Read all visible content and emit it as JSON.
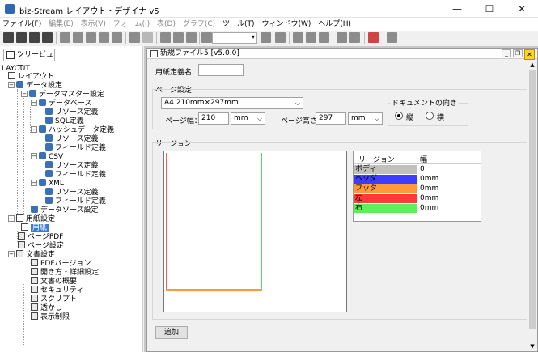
{
  "window": {
    "title": "biz-Stream レイアウト・デザイナ v5",
    "minimize": "—",
    "maximize": "☐",
    "close": "✕"
  },
  "menu": [
    {
      "label": "ファイル(F)",
      "enabled": true
    },
    {
      "label": "編集(E)",
      "enabled": false
    },
    {
      "label": "表示(V)",
      "enabled": false
    },
    {
      "label": "フォーム(I)",
      "enabled": false
    },
    {
      "label": "表(D)",
      "enabled": false
    },
    {
      "label": "グラフ(C)",
      "enabled": false
    },
    {
      "label": "ツール(T)",
      "enabled": true
    },
    {
      "label": "ウィンドウ(W)",
      "enabled": true
    },
    {
      "label": "ヘルプ(H)",
      "enabled": true
    }
  ],
  "toolbar": {
    "zoom_value": "",
    "zoom_arrow": "▾"
  },
  "tree_panel": {
    "tab_label": "ツリービュー",
    "root_label": "LAYOUT",
    "nodes": [
      {
        "label": "レイアウト",
        "expander": ""
      },
      {
        "label": "データ設定",
        "expander": "−"
      },
      {
        "label": "データマスター設定",
        "expander": "−"
      },
      {
        "label": "データベース",
        "expander": "−"
      },
      {
        "label": "リソース定義",
        "expander": ""
      },
      {
        "label": "SQL定義",
        "expander": ""
      },
      {
        "label": "ハッシュデータ定義",
        "expander": "−"
      },
      {
        "label": "リソース定義",
        "expander": ""
      },
      {
        "label": "フィールド定義",
        "expander": ""
      },
      {
        "label": "CSV",
        "expander": "−"
      },
      {
        "label": "リソース定義",
        "expander": ""
      },
      {
        "label": "フィールド定義",
        "expander": ""
      },
      {
        "label": "XML",
        "expander": "−"
      },
      {
        "label": "リソース定義",
        "expander": ""
      },
      {
        "label": "フィールド定義",
        "expander": ""
      },
      {
        "label": "データソース設定",
        "expander": ""
      },
      {
        "label": "用紙設定",
        "expander": "−"
      },
      {
        "label": "用紙",
        "expander": ""
      },
      {
        "label": "ページPDF",
        "expander": ""
      },
      {
        "label": "ページ設定",
        "expander": ""
      },
      {
        "label": "文書設定",
        "expander": "−"
      },
      {
        "label": "PDFバージョン",
        "expander": ""
      },
      {
        "label": "開き方・詳細設定",
        "expander": ""
      },
      {
        "label": "文書の概要",
        "expander": ""
      },
      {
        "label": "セキュリティ",
        "expander": ""
      },
      {
        "label": "スクリプト",
        "expander": ""
      },
      {
        "label": "透かし",
        "expander": ""
      },
      {
        "label": "表示制限",
        "expander": ""
      }
    ]
  },
  "doc_window": {
    "title": "新規ファイル5 [v5.0.0]",
    "close_button": "✕",
    "paper_name_label": "用紙定義名",
    "paper_name_value": "",
    "page_setting_label": "ページ設定",
    "paper_size": "A4 210mm×297mm",
    "width_label": "ページ幅：",
    "width_value": "210",
    "width_unit": "mm",
    "height_label": "ページ高さ：",
    "height_value": "297",
    "height_unit": "mm",
    "orientation_label": "ドキュメントの向き",
    "orientation_portrait": "縦",
    "orientation_landscape": "横",
    "region_label": "リージョン",
    "region_header_name": "リージョン",
    "region_header_width": "幅",
    "regions": [
      {
        "name": "ボディ",
        "value": "0",
        "color": "#c0c0c0"
      },
      {
        "name": "ヘッダ",
        "value": "0mm",
        "color": "#3d3dff"
      },
      {
        "name": "フッタ",
        "value": "0mm",
        "color": "#ff9a3a"
      },
      {
        "name": "左",
        "value": "0mm",
        "color": "#ff3a3a"
      },
      {
        "name": "右",
        "value": "0mm",
        "color": "#5cf05c"
      }
    ],
    "add_button": "追加"
  },
  "dropdown_arrow": "⌵",
  "child_buttons": {
    "min": "_",
    "restore": "❐",
    "close": "✕"
  },
  "scroll": {
    "up": "▲",
    "down": "▼"
  }
}
